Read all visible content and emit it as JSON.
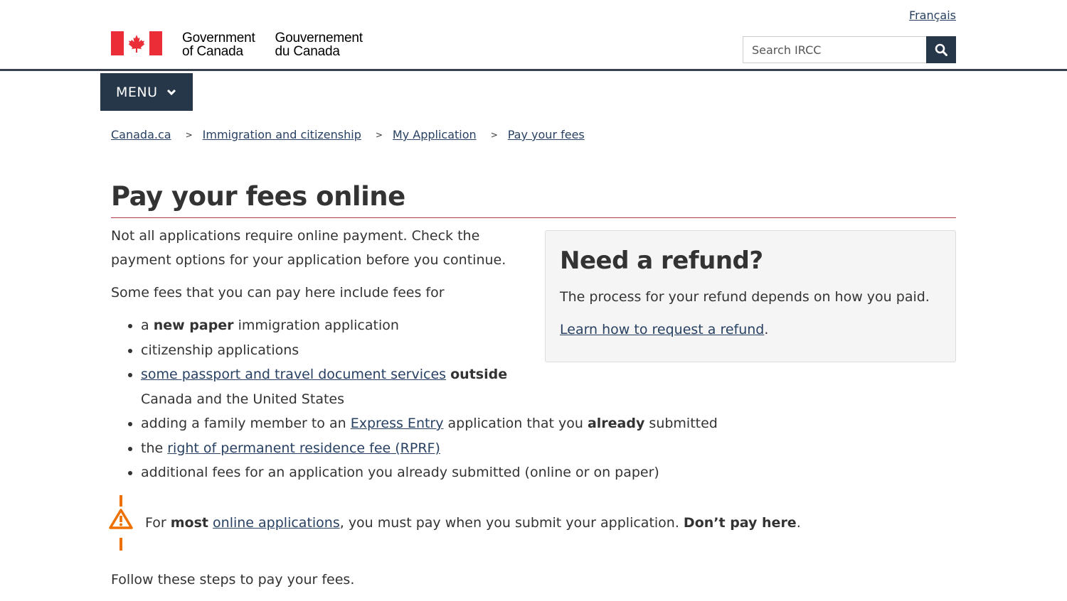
{
  "header": {
    "language_link": "Français",
    "brand": {
      "en_line1": "Government",
      "en_line2": "of Canada",
      "fr_line1": "Gouvernement",
      "fr_line2": "du Canada",
      "flag_color": "#eb2d37"
    },
    "search": {
      "placeholder": "Search IRCC",
      "icon": "search-icon"
    },
    "menu_label": "MENU"
  },
  "breadcrumb": [
    {
      "label": "Canada.ca"
    },
    {
      "label": "Immigration and citizenship"
    },
    {
      "label": "My Application"
    },
    {
      "label": "Pay your fees"
    }
  ],
  "breadcrumb_separator": ">",
  "page": {
    "title": "Pay your fees online",
    "intro": "Not all applications require online payment. Check the payment options for your application before you continue.",
    "lead": "Some fees that you can pay here include fees for",
    "list": {
      "item1": {
        "pre": "a ",
        "bold": "new paper",
        "post": " immigration application"
      },
      "item2": "citizenship applications",
      "item3": {
        "link": "some passport and travel document services",
        "bold": "outside",
        "post": "Canada and the United States"
      },
      "item4": {
        "pre": "adding a family member to an ",
        "link": "Express Entry",
        "mid": " application that you ",
        "bold": "already",
        "post": " submitted"
      },
      "item5": {
        "pre": "the ",
        "link": "right of permanent residence fee (RPRF)"
      },
      "item6": "additional fees for an application you already submitted (online or on paper)"
    },
    "warning": {
      "icon": "warning-icon",
      "pre": "For ",
      "bold1": "most",
      "link": "online applications",
      "mid": ", you must pay when you submit your application. ",
      "bold2": "Don’t pay here",
      "post": "."
    },
    "follow": "Follow these steps to pay your fees."
  },
  "refund": {
    "title": "Need a refund?",
    "text": "The process for your refund depends on how you paid.",
    "link": "Learn how to request a refund",
    "link_suffix": "."
  },
  "colors": {
    "link": "#284162",
    "menu_bg": "#26374a",
    "title_rule": "#af3c43",
    "warning": "#ee7100"
  }
}
